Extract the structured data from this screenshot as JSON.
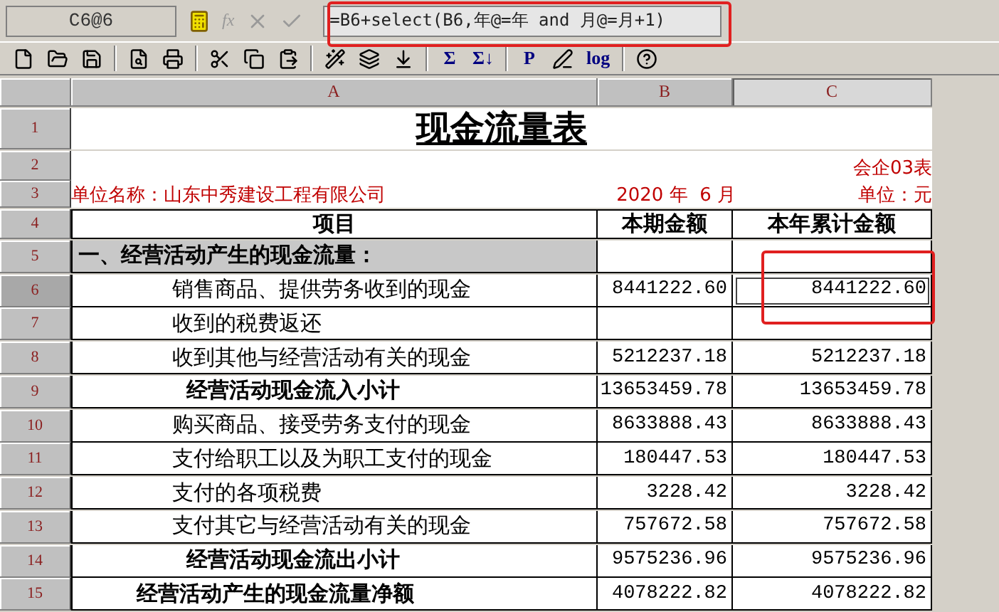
{
  "formula_bar": {
    "cell_ref": "C6@6",
    "function_label": "fx",
    "formula": "=B6+select(B6,年@=年 and 月@=月+1)"
  },
  "toolbar": [
    {
      "kind": "new"
    },
    {
      "kind": "open"
    },
    {
      "kind": "save"
    },
    {
      "kind": "sep"
    },
    {
      "kind": "preview"
    },
    {
      "kind": "print"
    },
    {
      "kind": "sep"
    },
    {
      "kind": "cut"
    },
    {
      "kind": "copy"
    },
    {
      "kind": "paste"
    },
    {
      "kind": "sep"
    },
    {
      "kind": "wand"
    },
    {
      "kind": "stack"
    },
    {
      "kind": "sortdown"
    },
    {
      "kind": "sep"
    },
    {
      "kind": "text",
      "label": "Σ"
    },
    {
      "kind": "text",
      "label": "Σ↓"
    },
    {
      "kind": "sep"
    },
    {
      "kind": "text",
      "label": "P"
    },
    {
      "kind": "pen"
    },
    {
      "kind": "text",
      "label": "log"
    },
    {
      "kind": "sep"
    },
    {
      "kind": "help"
    }
  ],
  "columns": [
    {
      "label": "A",
      "selected": false
    },
    {
      "label": "B",
      "selected": false
    },
    {
      "label": "C",
      "selected": true
    }
  ],
  "title": "现金流量表",
  "form_code": "会企03表",
  "company": "单位名称：山东中秀建设工程有限公司",
  "period": "2020 年  6 月",
  "unit": "单位：元",
  "headers": [
    "项目",
    "本期金额",
    "本年累计金额"
  ],
  "row_numbers": [
    "1",
    "2",
    "3",
    "4",
    "5",
    "6",
    "7",
    "8",
    "9",
    "10",
    "11",
    "12",
    "13",
    "14",
    "15"
  ],
  "rows": [
    {
      "kind": "section",
      "label": "一、经营活动产生的现金流量：",
      "b": "",
      "c": ""
    },
    {
      "kind": "item",
      "label": "销售商品、提供劳务收到的现金",
      "b": "8441222.60",
      "c": "8441222.60",
      "selected": true
    },
    {
      "kind": "item",
      "label": "收到的税费返还",
      "b": "",
      "c": "",
      "selected": false
    },
    {
      "kind": "item",
      "label": "收到其他与经营活动有关的现金",
      "b": "5212237.18",
      "c": "5212237.18",
      "selected": false
    },
    {
      "kind": "subtotal",
      "label": "经营活动现金流入小计",
      "b": "13653459.78",
      "c": "13653459.78",
      "selected": false
    },
    {
      "kind": "item",
      "label": "购买商品、接受劳务支付的现金",
      "b": "8633888.43",
      "c": "8633888.43",
      "selected": false
    },
    {
      "kind": "item",
      "label": "支付给职工以及为职工支付的现金",
      "b": "180447.53",
      "c": "180447.53",
      "selected": false
    },
    {
      "kind": "item",
      "label": "支付的各项税费",
      "b": "3228.42",
      "c": "3228.42",
      "selected": false
    },
    {
      "kind": "item",
      "label": "支付其它与经营活动有关的现金",
      "b": "757672.58",
      "c": "757672.58",
      "selected": false
    },
    {
      "kind": "subtotal",
      "label": "经营活动现金流出小计",
      "b": "9575236.96",
      "c": "9575236.96",
      "selected": false
    },
    {
      "kind": "total",
      "label": "经营活动产生的现金流量净额",
      "b": "4078222.82",
      "c": "4078222.82",
      "selected": false
    }
  ]
}
